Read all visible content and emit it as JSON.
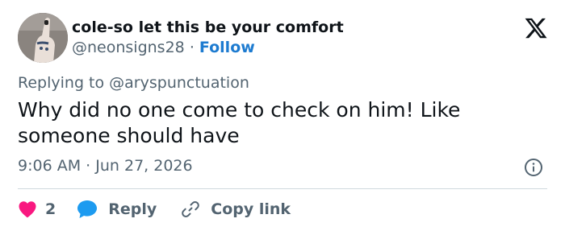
{
  "tweet": {
    "author": {
      "display_name": "cole-so let this be your comfort",
      "handle": "@neonsigns28",
      "separator": "·",
      "follow_label": "Follow"
    },
    "replying_to": "Replying to @aryspunctuation",
    "text": "Why did no one come to check on him! Like someone should have",
    "time": "9:06 AM",
    "date_separator": "·",
    "date": "Jun 27, 2026"
  },
  "actions": {
    "like_count": "2",
    "reply_label": "Reply",
    "copy_link_label": "Copy link"
  },
  "colors": {
    "text": "#0f1419",
    "secondary": "#536471",
    "link": "#1d7bd0",
    "like": "#f91880",
    "reply": "#1d9bf0",
    "divider": "#cfd9de"
  },
  "icons": {
    "logo": "x-logo-icon",
    "info": "info-icon",
    "like": "heart-icon",
    "reply": "speech-bubble-icon",
    "copy_link": "link-icon"
  }
}
